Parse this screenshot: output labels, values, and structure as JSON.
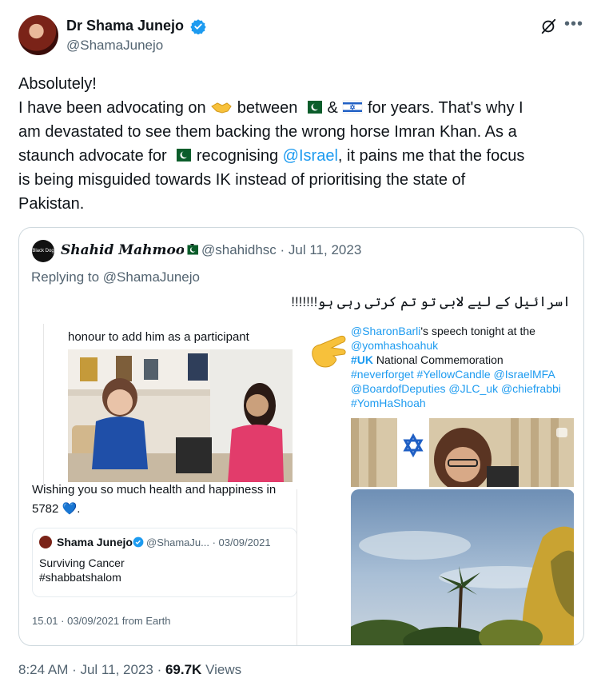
{
  "author": {
    "display_name": "Dr Shama Junejo",
    "handle": "@ShamaJunejo"
  },
  "tweet": {
    "line1": "Absolutely!",
    "line2_a": "I have been advocating on",
    "line2_b": "between",
    "line2_c": "&",
    "line2_d": "for years. That's why I",
    "line3": "am devastated to see them backing the wrong horse Imran Khan. As a",
    "line4_a": "staunch advocate for",
    "line4_b": "recognising",
    "line4_mention": "@Israel",
    "line4_c": ", it pains me that the focus",
    "line5": "is being misguided towards IK instead of prioritising the state of",
    "line6": "Pakistan."
  },
  "quote": {
    "name": "Shahid Mahmood",
    "avatar_text": "Black Dog",
    "handle_date": "@shahidhsc · Jul 11, 2023",
    "replying": "Replying to @ShamaJunejo",
    "urdu_text": "اسرائیل کے لیے لابی تو تم کرتی رہی ہو!!!!!!!"
  },
  "media": {
    "top_left_caption": "honour to add him as a participant",
    "top_right": {
      "mention1": "@SharonBarli",
      "text1": "'s speech tonight at the",
      "mention2": "@yomhashoahuk",
      "hashtag_uk": "#UK",
      "text2": " National Commemoration",
      "line4": "#neverforget #YellowCandle @IsraelMFA",
      "line5": "@BoardofDeputies @JLC_uk @chiefrabbi",
      "line6": "#YomHaShoah"
    },
    "bottom_left": {
      "cut_text": "Wishing you so much health and happiness in",
      "year_text": "5782 💙.",
      "inner_name": "Shama Junejo",
      "inner_handle_date": "@ShamaJu... · 03/09/2021",
      "inner_line1": "Surviving Cancer",
      "inner_line2": "#shabbatshalom",
      "inner_footer": "15.01 · 03/09/2021 from Earth"
    }
  },
  "footer": {
    "time_date": "8:24 AM · Jul 11, 2023 · ",
    "views_count": "69.7K",
    "views_label": " Views"
  },
  "colors": {
    "accent": "#1d9bf0",
    "text": "#0f1419",
    "muted": "#536471",
    "border": "#cfd9de"
  },
  "icons": [
    "verified-badge-icon",
    "grok-icon",
    "more-icon",
    "handshake-emoji",
    "pakistan-flag",
    "israel-flag",
    "pointing-hand-emoji",
    "blue-heart-emoji"
  ]
}
